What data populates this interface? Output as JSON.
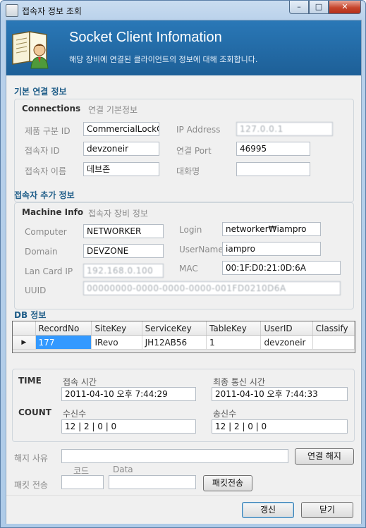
{
  "window": {
    "title": "접속자 정보 조회",
    "min": "–",
    "max": "□",
    "close": "✕"
  },
  "header": {
    "title": "Socket Client Infomation",
    "subtitle": "해당 장비에 연결된 클라이언트의 정보에 대해 조회합니다."
  },
  "basic": {
    "section_title": "기본 연결 정보",
    "group_head": "Connections",
    "group_sub": "연결 기본정보",
    "product_label": "제품 구분 ID",
    "product_value": "CommercialLockClient",
    "ip_label": "IP Address",
    "ip_value": "127.0.0.1",
    "user_id_label": "접속자 ID",
    "user_id_value": "devzoneir",
    "port_label": "연결 Port",
    "port_value": "46995",
    "user_name_label": "접속자 이름",
    "user_name_value": "데브존",
    "nick_label": "대화명",
    "nick_value": ""
  },
  "extra": {
    "section_title": "접속자 추가 정보",
    "group_head": "Machine Info",
    "group_sub": "접속자 장비 정보",
    "computer_label": "Computer",
    "computer_value": "NETWORKER",
    "login_label": "Login",
    "login_value": "networker₩iampro",
    "domain_label": "Domain",
    "domain_value": "DEVZONE",
    "username_label": "UserName",
    "username_value": "iampro",
    "lan_label": "Lan Card IP",
    "lan_value": "192.168.0.100",
    "mac_label": "MAC",
    "mac_value": "00:1F:D0:21:0D:6A",
    "uuid_label": "UUID",
    "uuid_value": "00000000-0000-0000-0000-001FD0210D6A"
  },
  "db": {
    "section_title": "DB 정보",
    "columns": [
      "RecordNo",
      "SiteKey",
      "ServiceKey",
      "TableKey",
      "UserID",
      "Classify"
    ],
    "row": [
      "177",
      "IRevo",
      "JH12AB56",
      "1",
      "devzoneir",
      ""
    ],
    "row_marker": "▶"
  },
  "stats": {
    "time_label": "TIME",
    "count_label": "COUNT",
    "connect_time_label": "접속 시간",
    "connect_time_value": "2011-04-10 오후 7:44:29",
    "last_comm_label": "최종 통신 시간",
    "last_comm_value": "2011-04-10 오후 7:44:33",
    "recv_label": "수신수",
    "recv_value": "12 | 2 | 0 | 0",
    "send_label": "송신수",
    "send_value": "12 | 2 | 0 | 0"
  },
  "bottom": {
    "reason_label": "해지 사유",
    "reason_value": "",
    "disconnect_button": "연결 해지",
    "code_label": "코드",
    "data_label": "Data",
    "packet_label": "패킷 전송",
    "code_value": "",
    "data_value": "",
    "send_packet_button": "패킷전송",
    "refresh_button": "갱신",
    "close_button": "닫기"
  }
}
